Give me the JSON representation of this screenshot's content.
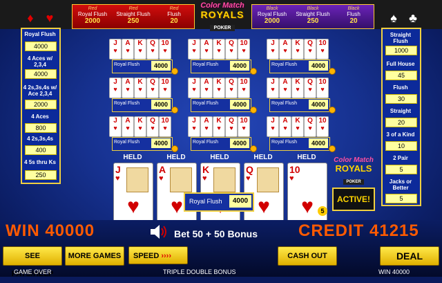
{
  "top": {
    "red_panel": [
      {
        "color": "Red",
        "name": "Royal Flush",
        "value": "2000"
      },
      {
        "color": "Red",
        "name": "Straight Flush",
        "value": "250"
      },
      {
        "color": "Red",
        "name": "Flush",
        "value": "20"
      }
    ],
    "black_panel": [
      {
        "color": "Black",
        "name": "Royal Flush",
        "value": "2000"
      },
      {
        "color": "Black",
        "name": "Straight Flush",
        "value": "250"
      },
      {
        "color": "Black",
        "name": "Flush",
        "value": "20"
      }
    ],
    "logo": {
      "line1": "Color Match",
      "line2": "ROYALS",
      "line3": "POKER"
    }
  },
  "left_paytable": [
    {
      "label": "Royal Flush",
      "value": "4000"
    },
    {
      "label": "4 Aces w/ 2,3,4",
      "value": "4000"
    },
    {
      "label": "4 2s,3s,4s w/ Ace 2,3,4",
      "value": "2000"
    },
    {
      "label": "4 Aces",
      "value": "800"
    },
    {
      "label": "4 2s,3s,4s",
      "value": "400"
    },
    {
      "label": "4 5s thru Ks",
      "value": "250"
    }
  ],
  "right_paytable": [
    {
      "label": "Straight Flush",
      "value": "1000"
    },
    {
      "label": "Full House",
      "value": "45"
    },
    {
      "label": "Flush",
      "value": "30"
    },
    {
      "label": "Straight",
      "value": "20"
    },
    {
      "label": "3 of a Kind",
      "value": "10"
    },
    {
      "label": "2 Pair",
      "value": "5"
    },
    {
      "label": "Jacks or Better",
      "value": "5"
    }
  ],
  "mini_hand": {
    "cards": [
      "J",
      "A",
      "K",
      "Q",
      "10"
    ],
    "suit_glyph": "♥",
    "result": "Royal Flush",
    "win": "4000"
  },
  "main_hand": {
    "held_label": "HELD",
    "cards": [
      {
        "rank": "J",
        "held": true
      },
      {
        "rank": "A",
        "held": true
      },
      {
        "rank": "K",
        "held": true
      },
      {
        "rank": "Q",
        "held": true
      },
      {
        "rank": "10",
        "held": true
      }
    ],
    "suit_glyph": "♥",
    "result": "Royal Flush",
    "win": "4000",
    "bet_chip": "5"
  },
  "active_logo": {
    "line1": "Color Match",
    "line2": "ROYALS",
    "line3": "POKER",
    "status": "ACTIVE!"
  },
  "bottom": {
    "win_text": "WIN 40000",
    "credit_text": "CREDIT 41215",
    "bet_text": "Bet 50 + 50 Bonus",
    "buttons": {
      "see_pays": "SEE PAYS/HELP",
      "more_games": "MORE GAMES",
      "speed": "SPEED",
      "speed_arrows": "››››",
      "cash_out": "CASH OUT",
      "deal": "DEAL"
    },
    "status_left": "GAME OVER",
    "status_center": "TRIPLE DOUBLE BONUS",
    "status_right": "WIN 40000"
  },
  "colors": {
    "accent_gold": "#f0d040",
    "win_orange": "#ff5a00",
    "card_red": "#d10000"
  }
}
